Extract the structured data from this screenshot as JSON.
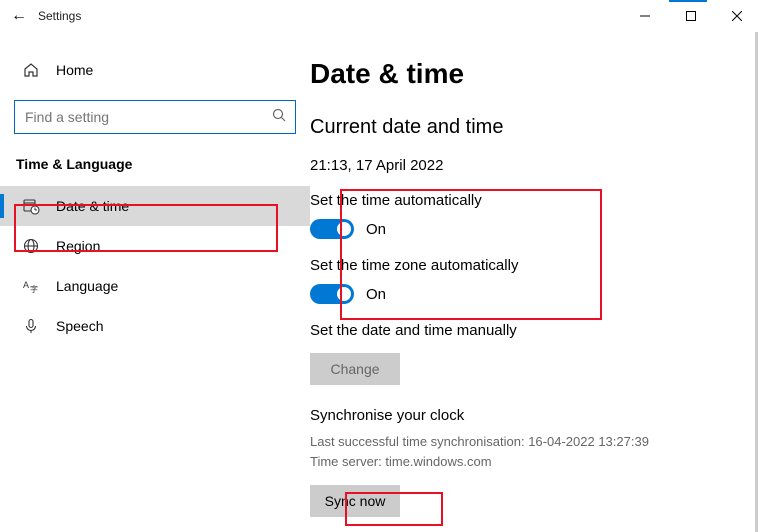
{
  "titlebar": {
    "title": "Settings"
  },
  "sidebar": {
    "home": "Home",
    "search_placeholder": "Find a setting",
    "section": "Time & Language",
    "items": [
      {
        "label": "Date & time"
      },
      {
        "label": "Region"
      },
      {
        "label": "Language"
      },
      {
        "label": "Speech"
      }
    ]
  },
  "main": {
    "heading": "Date & time",
    "subheading": "Current date and time",
    "datetime": "21:13, 17 April 2022",
    "auto_time_label": "Set the time automatically",
    "auto_time_state": "On",
    "auto_zone_label": "Set the time zone automatically",
    "auto_zone_state": "On",
    "manual_label": "Set the date and time manually",
    "change_btn": "Change",
    "sync_heading": "Synchronise your clock",
    "sync_last": "Last successful time synchronisation: 16-04-2022 13:27:39",
    "sync_server": "Time server: time.windows.com",
    "sync_btn": "Sync now"
  }
}
